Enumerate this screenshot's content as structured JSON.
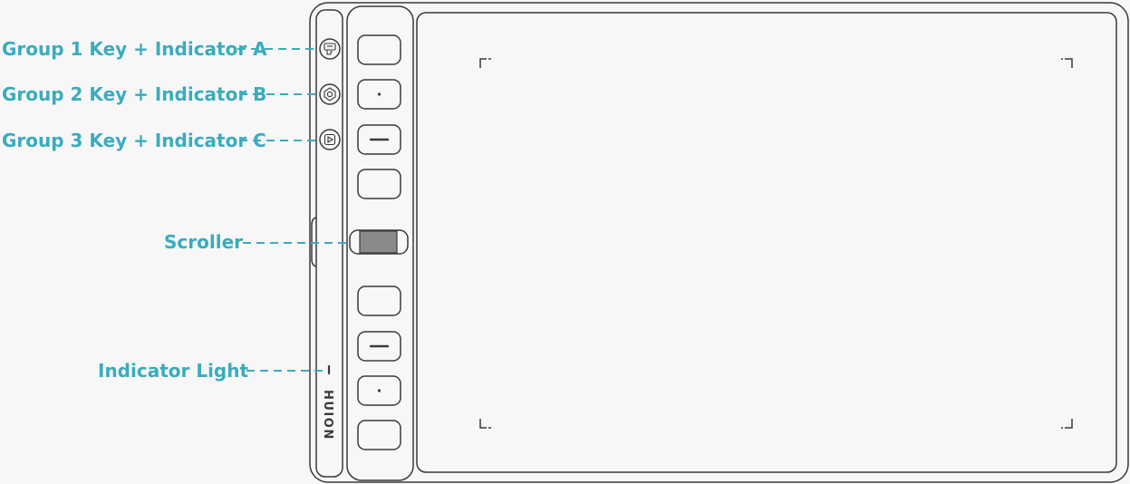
{
  "brand": "HUION",
  "colors": {
    "accent": "#3aacbe",
    "outline": "#3a3a3a",
    "background": "#f7f7f7",
    "scroller_fill": "#8a8a8a"
  },
  "labels": {
    "group1": "Group 1 Key + Indicator A",
    "group2": "Group 2 Key + Indicator B",
    "group3": "Group 3 Key + Indicator C",
    "scroller": "Scroller",
    "indicator_light": "Indicator Light"
  },
  "group_key_icons": [
    "key-a-icon",
    "key-b-icon",
    "key-c-icon"
  ],
  "express_keys": [
    {
      "name": "express-key-1",
      "mark": "none"
    },
    {
      "name": "express-key-2",
      "mark": "dot"
    },
    {
      "name": "express-key-3",
      "mark": "dash"
    },
    {
      "name": "express-key-4",
      "mark": "none"
    },
    {
      "name": "express-key-5",
      "mark": "none"
    },
    {
      "name": "express-key-6",
      "mark": "dash"
    },
    {
      "name": "express-key-7",
      "mark": "dot"
    },
    {
      "name": "express-key-8",
      "mark": "none"
    }
  ]
}
